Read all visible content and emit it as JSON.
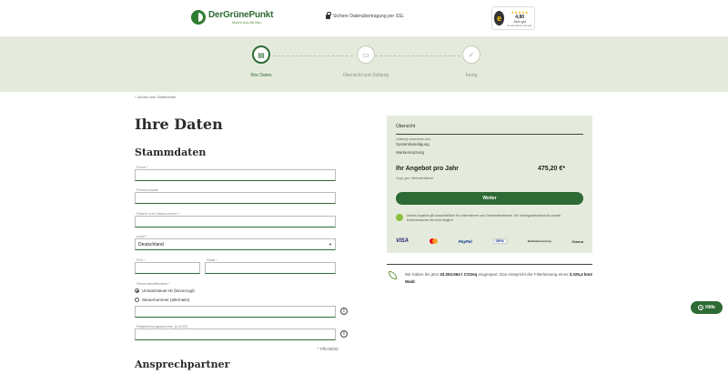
{
  "header": {
    "logo_name": "DerGrünePunkt",
    "logo_tagline": "Macht aus Alt Neu",
    "ssl_text": "Sichere Datenübertragung per SSL",
    "trust": {
      "seal": "e",
      "stars": "★★★★★",
      "score": "4,80",
      "label": "Sehr gut",
      "count": "Kundenbewertungen"
    }
  },
  "steps": [
    {
      "label": "Ihre Daten",
      "icon": "document-icon",
      "glyph": "▤",
      "active": true
    },
    {
      "label": "Übersicht und Zahlung",
      "icon": "card-icon",
      "glyph": "▭",
      "active": false
    },
    {
      "label": "Fertig",
      "icon": "check-icon",
      "glyph": "✓",
      "active": false
    }
  ],
  "main": {
    "back_link": "‹  Zurück zum Tarifrechner",
    "page_title": "Ihre Daten",
    "stammdaten_title": "Stammdaten",
    "ansprechpartner_title": "Ansprechpartner",
    "required_note": "* Pflichtfeld"
  },
  "form": {
    "firma_label": "Firma *",
    "firma_value": "",
    "zusatz_label": "Firmenzusatz",
    "zusatz_value": "",
    "strasse_label": "Straße und Hausnummer *",
    "strasse_value": "",
    "land_label": "Land *",
    "land_value": "Deutschland",
    "plz_label": "PLZ *",
    "plz_value": "",
    "stadt_label": "Stadt *",
    "stadt_value": "",
    "steuer_label": "Steueridentifikation *",
    "radio1": "Umsatzsteuer-ID (bevorzugt)",
    "radio2": "Steuernummer (alternativ)",
    "steuer_value": "",
    "register_label": "Registrierungsnummer (LUCID)",
    "register_value": ""
  },
  "overview": {
    "title": "Übersicht",
    "small_note": "Leistung zusammen aus:",
    "item1": "Systembeteiligung",
    "item2": "Markennutzung",
    "offer_label": "Ihr Angebot pro Jahr",
    "offer_price": "475,20 €*",
    "vat_note": "*zzgl. ges. Mehrwertsteuer",
    "weiter_label": "Weiter",
    "notice": "Dieses Angebot gilt ausschließlich für Unternehmer und Gewerbetreibende. Ein Vertragsabschluss für private Endverbraucher ist nicht möglich.",
    "payments": [
      "VISA",
      "PayPal",
      "SEPA",
      "Banküberweisung",
      "Klarna"
    ]
  },
  "co2": {
    "text_prefix": "Wir haben bis jetzt ",
    "amount": "33.253.564 t CO2eq",
    "text_mid": " eingespart. Das entspricht der Filterleistung eines ",
    "area": "3.325,4 km2 Wald",
    "text_suffix": "."
  },
  "help": {
    "label": "Hilfe"
  },
  "colors": {
    "brand_green": "#2e6b34",
    "band_bg": "#e5ebdc"
  }
}
